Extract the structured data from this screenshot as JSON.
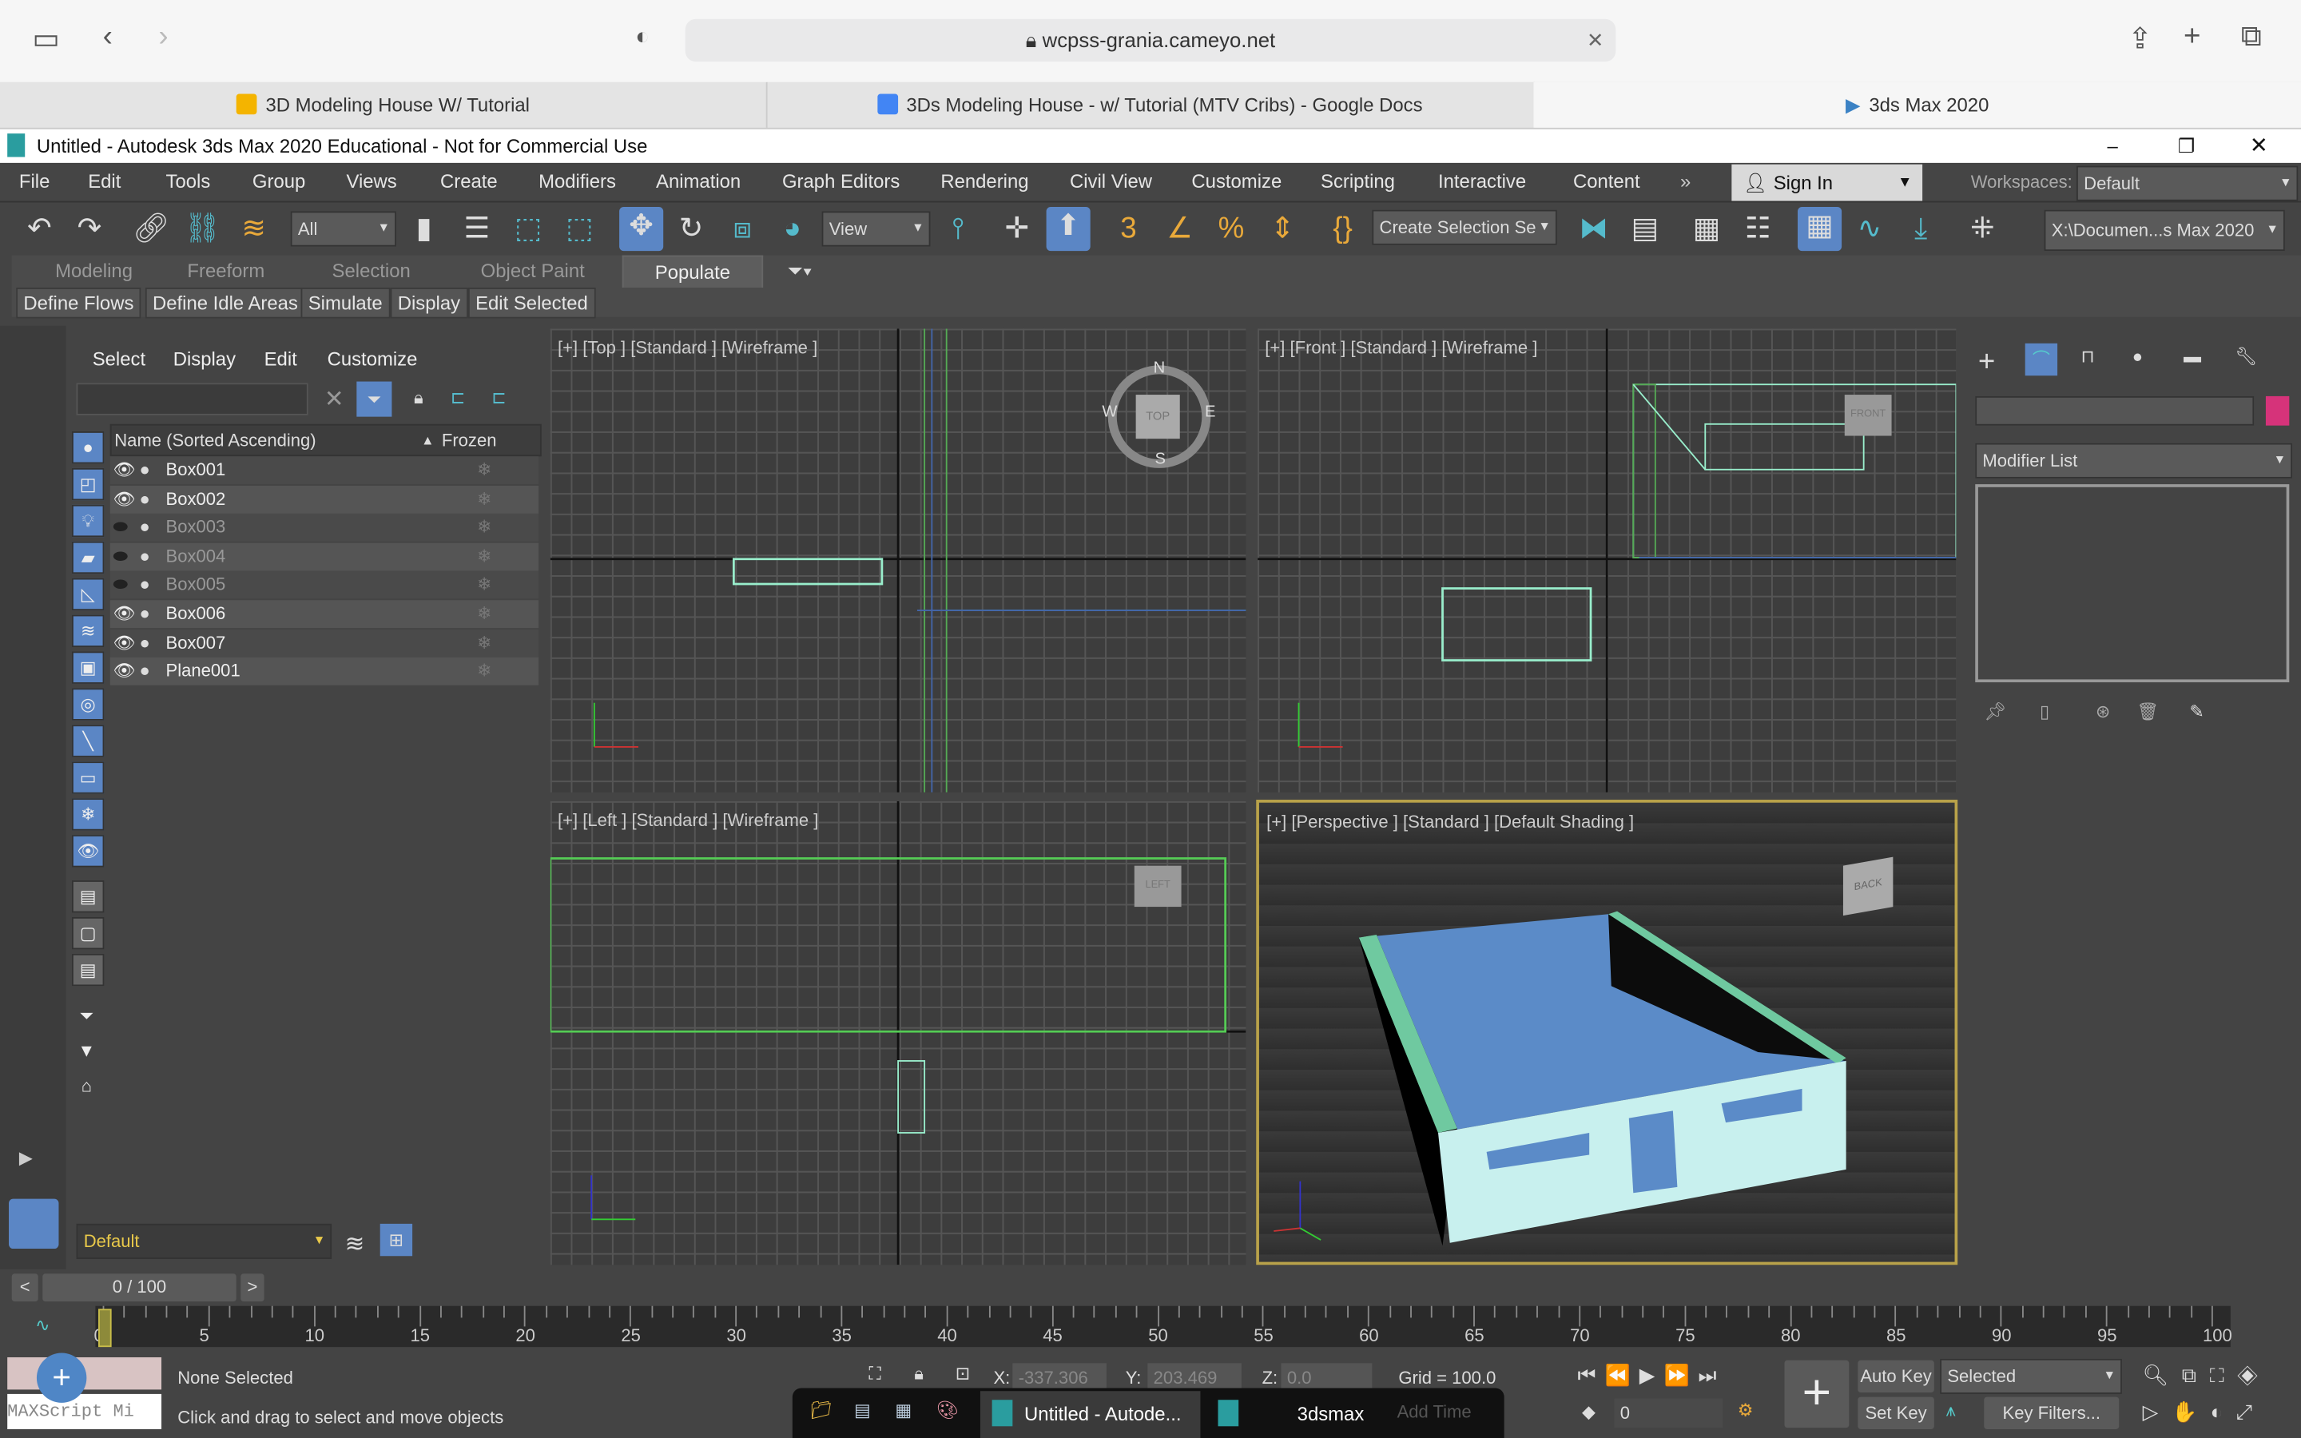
{
  "browser": {
    "url": "wcpss-grania.cameyo.net",
    "tabs": [
      {
        "label": "3D Modeling House W/ Tutorial",
        "color": "#f4b400"
      },
      {
        "label": "3Ds Modeling House - w/ Tutorial (MTV Cribs) - Google Docs",
        "color": "#4285f4"
      },
      {
        "label": "3ds Max 2020",
        "color": "#3b82c4"
      }
    ]
  },
  "window": {
    "title": "Untitled - Autodesk 3ds Max 2020 Educational - Not for Commercial Use"
  },
  "menu": [
    "File",
    "Edit",
    "Tools",
    "Group",
    "Views",
    "Create",
    "Modifiers",
    "Animation",
    "Graph Editors",
    "Rendering",
    "Civil View",
    "Customize",
    "Scripting",
    "Interactive",
    "Content"
  ],
  "signin": "Sign In",
  "workspaces": {
    "label": "Workspaces:",
    "value": "Default"
  },
  "toolbar": {
    "filter": "All",
    "refcoord": "View",
    "selset": "Create Selection Se",
    "project": "X:\\Documen...s Max 2020"
  },
  "ribbon": {
    "tabs": [
      "Modeling",
      "Freeform",
      "Selection",
      "Object Paint",
      "Populate"
    ],
    "active": "Populate",
    "buttons": [
      "Define Flows",
      "Define Idle Areas",
      "Simulate",
      "Display",
      "Edit Selected"
    ]
  },
  "explorer": {
    "menu": [
      "Select",
      "Display",
      "Edit",
      "Customize"
    ],
    "col_name": "Name (Sorted Ascending)",
    "col_frozen": "Frozen",
    "rows": [
      {
        "name": "Box001",
        "visible": true
      },
      {
        "name": "Box002",
        "visible": true
      },
      {
        "name": "Box003",
        "visible": false
      },
      {
        "name": "Box004",
        "visible": false
      },
      {
        "name": "Box005",
        "visible": false
      },
      {
        "name": "Box006",
        "visible": true
      },
      {
        "name": "Box007",
        "visible": true
      },
      {
        "name": "Plane001",
        "visible": true
      }
    ],
    "layer": "Default"
  },
  "viewports": {
    "top": "[+] [Top ] [Standard ] [Wireframe ]",
    "front": "[+] [Front ] [Standard ] [Wireframe ]",
    "left": "[+] [Left ] [Standard ] [Wireframe ]",
    "perspective": "[+] [Perspective ] [Standard ] [Default Shading ]",
    "compass": {
      "n": "N",
      "s": "S",
      "e": "E",
      "w": "W",
      "top": "TOP",
      "front": "FRONT",
      "left": "LEFT",
      "back": "BACK"
    }
  },
  "command": {
    "modifier_list": "Modifier List",
    "color_swatch": "#d6337a"
  },
  "timeline": {
    "slider": "0 / 100",
    "ticks": [
      "0",
      "5",
      "10",
      "15",
      "20",
      "25",
      "30",
      "35",
      "40",
      "45",
      "50",
      "55",
      "60",
      "65",
      "70",
      "75",
      "80",
      "85",
      "90",
      "95",
      "100"
    ]
  },
  "status": {
    "selection": "None Selected",
    "prompt": "Click and drag to select and move objects",
    "maxscript": "MAXScript Mi",
    "x_label": "X:",
    "x": "-337.306",
    "y_label": "Y:",
    "y": "203.469",
    "z_label": "Z:",
    "z": "0.0",
    "grid": "Grid = 100.0",
    "auto_key": "Auto Key",
    "set_key": "Set Key",
    "key_mode": "Selected",
    "key_filters": "Key Filters...",
    "frame": "0"
  },
  "taskbar": {
    "items": [
      "Untitled - Autode...",
      "3dsmax",
      "Add Time"
    ]
  }
}
